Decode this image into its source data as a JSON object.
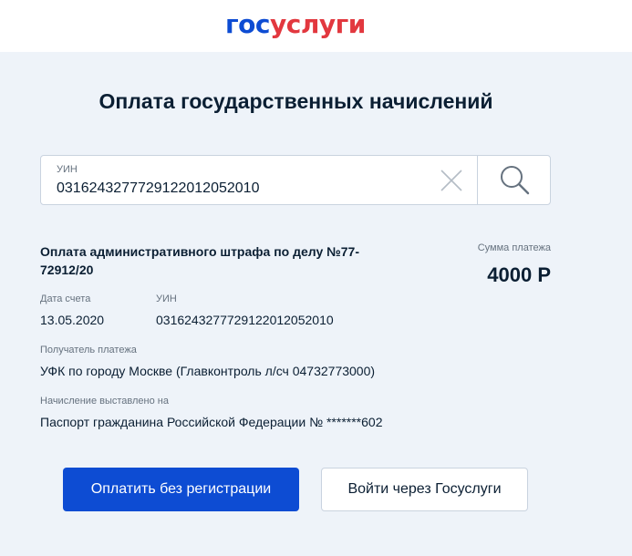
{
  "header": {
    "logo_part1": "гос",
    "logo_part2": "услуги"
  },
  "page": {
    "title": "Оплата государственных начислений"
  },
  "search": {
    "label": "УИН",
    "value": "03162432777291220120520­10"
  },
  "bill": {
    "title": "Оплата административного штрафа по делу №77-72912/20",
    "sum_label": "Сумма платежа",
    "sum_value": "4000 Р",
    "date_label": "Дата счета",
    "date_value": "13.05.2020",
    "uin_label": "УИН",
    "uin_value": "0316243277729122012052010",
    "recipient_label": "Получатель платежа",
    "recipient_value": "УФК по городу Москве (Главконтроль л/сч 04732773000)",
    "issued_label": "Начисление выставлено на",
    "issued_value": "Паспорт гражданина Российской Федерации № *******602"
  },
  "actions": {
    "pay_label": "Оплатить без регистрации",
    "login_label": "Войти через Госуслуги"
  },
  "colors": {
    "primary": "#0d4cd3",
    "logo_red": "#e2383f",
    "background": "#eef3f9"
  }
}
